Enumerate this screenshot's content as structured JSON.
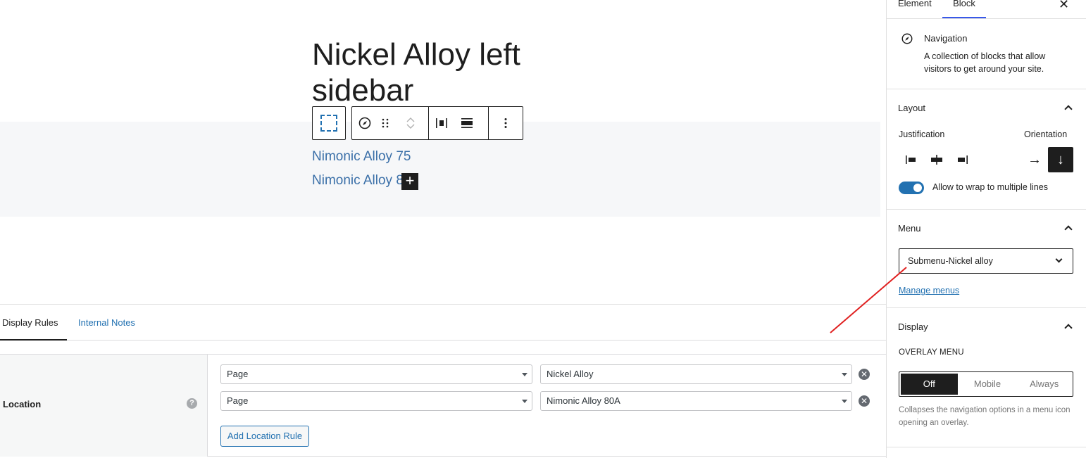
{
  "canvas": {
    "title": "Nickel Alloy left sidebar",
    "nav_links": [
      "Nimonic Alloy 75",
      "Nimonic Alloy 8"
    ],
    "inserter_icon": "plus-icon",
    "toolbar": {
      "icons": [
        "select-parent-icon",
        "compass-icon",
        "drag-handle-icon",
        "move-up-icon",
        "move-down-icon",
        "justify-icon",
        "align-icon",
        "more-options-icon"
      ]
    }
  },
  "meta_box": {
    "tabs": [
      {
        "label": "Display Rules",
        "active": true
      },
      {
        "label": "Internal Notes",
        "active": false
      }
    ],
    "location_label": "Location",
    "help_symbol": "?",
    "rules": [
      {
        "param": "Page",
        "value": "Nickel Alloy"
      },
      {
        "param": "Page",
        "value": "Nimonic Alloy 80A"
      }
    ],
    "remove_symbol": "✕",
    "add_rule_label": "Add Location Rule"
  },
  "sidebar": {
    "tabs": [
      "Element",
      "Block"
    ],
    "active_tab": "Block",
    "close_symbol": "✕",
    "block": {
      "icon": "compass-icon",
      "title": "Navigation",
      "description": "A collection of blocks that allow visitors to get around your site."
    },
    "layout": {
      "title": "Layout",
      "justification_label": "Justification",
      "orientation_label": "Orientation",
      "orientation_icons": [
        "arrow-right-icon",
        "arrow-down-icon"
      ],
      "selected_orientation": "vertical",
      "wrap_label": "Allow to wrap to multiple lines",
      "wrap_enabled": true
    },
    "menu": {
      "title": "Menu",
      "selected": "Submenu-Nickel alloy",
      "manage_link": "Manage menus"
    },
    "display": {
      "title": "Display",
      "overlay_label": "OVERLAY MENU",
      "options": [
        "Off",
        "Mobile",
        "Always"
      ],
      "selected_option": "Off",
      "help": "Collapses the navigation options in a menu icon opening an overlay."
    }
  },
  "colors": {
    "accent": "#2271b1",
    "link": "#3a6fa8",
    "annotation": "#e02020",
    "dark": "#1e1e1e"
  }
}
